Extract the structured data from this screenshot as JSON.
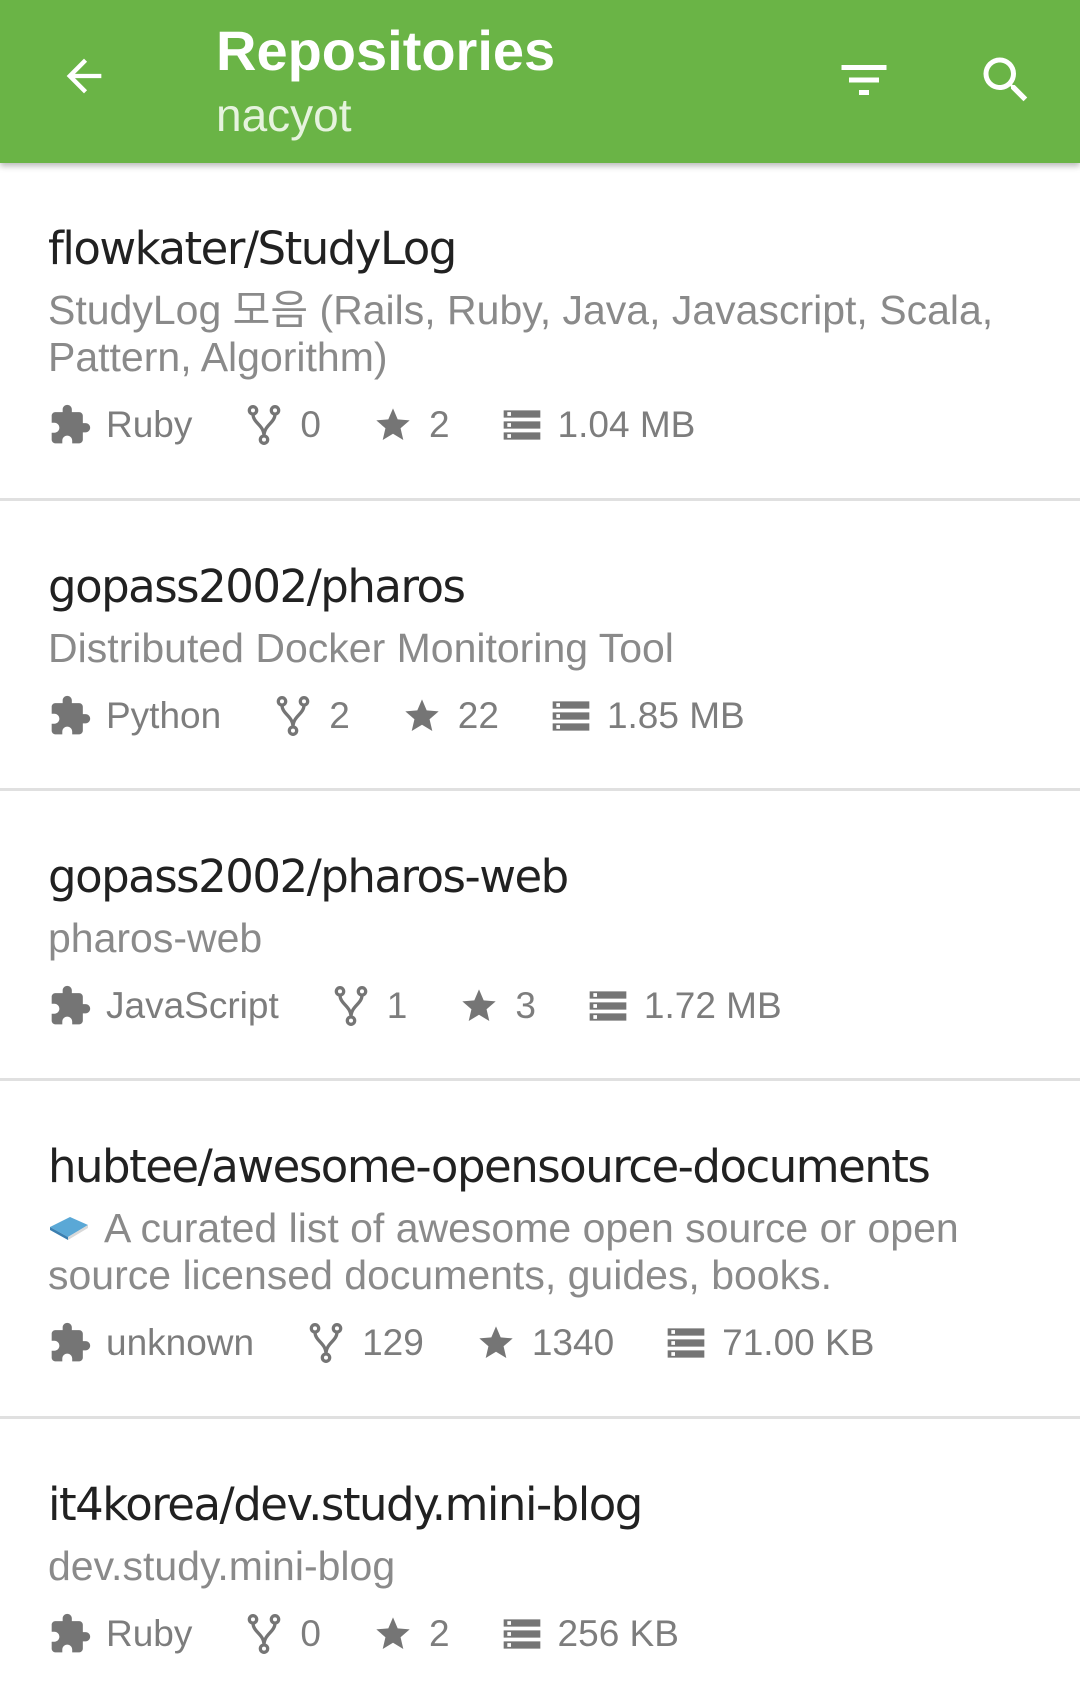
{
  "appbar": {
    "title": "Repositories",
    "subtitle": "nacyot",
    "color": "#6ab446",
    "back_icon": "arrow-left-icon",
    "filter_icon": "filter-icon",
    "search_icon": "search-icon"
  },
  "repos": [
    {
      "name": "flowkater/StudyLog",
      "description": "StudyLog 모음 (Rails, Ruby, Java, Javascript, Scala, Pattern, Algorithm)",
      "language": "Ruby",
      "forks": "0",
      "stars": "2",
      "size": "1.04 MB"
    },
    {
      "name": "gopass2002/pharos",
      "description": "Distributed Docker Monitoring Tool",
      "language": "Python",
      "forks": "2",
      "stars": "22",
      "size": "1.85 MB"
    },
    {
      "name": "gopass2002/pharos-web",
      "description": "pharos-web",
      "language": "JavaScript",
      "forks": "1",
      "stars": "3",
      "size": "1.72 MB"
    },
    {
      "name": "hubtee/awesome-opensource-documents",
      "description": "A curated list of awesome open source or open source licensed documents, guides, books.",
      "description_icon": "book-emoji-icon",
      "language": "unknown",
      "forks": "129",
      "stars": "1340",
      "size": "71.00 KB"
    },
    {
      "name": "it4korea/dev.study.mini-blog",
      "description": "dev.study.mini-blog",
      "language": "Ruby",
      "forks": "0",
      "stars": "2",
      "size": "256 KB"
    }
  ],
  "meta_icons": {
    "language": "puzzle-icon",
    "forks": "fork-icon",
    "stars": "star-icon",
    "size": "storage-icon"
  }
}
